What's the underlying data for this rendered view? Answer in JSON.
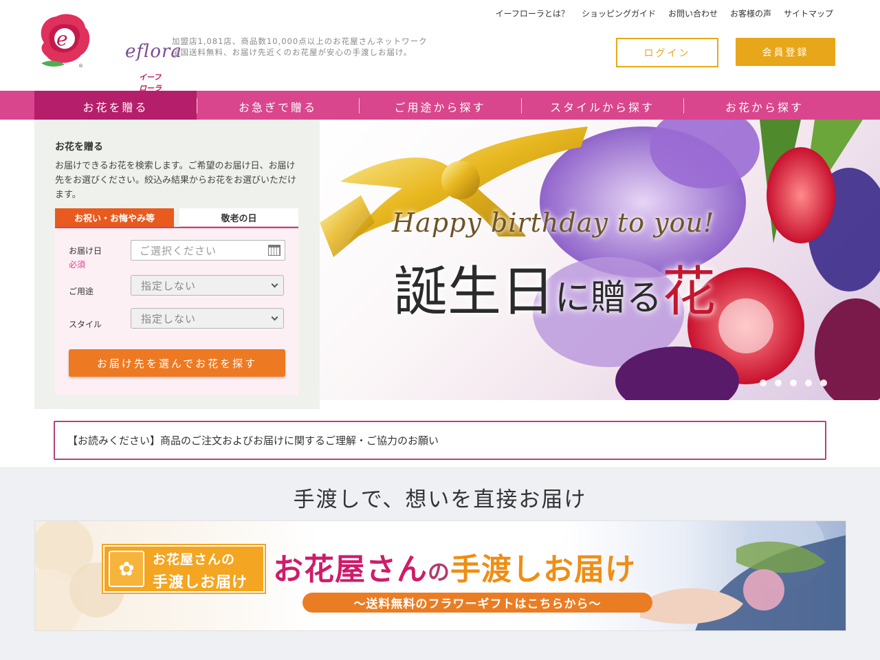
{
  "header": {
    "logo_text": "eflora",
    "logo_sub": "イーフローラ",
    "tagline_line1": "加盟店1,081店、商品数10,000点以上のお花屋さんネットワーク",
    "tagline_line2": "全国送料無料、お届け先近くのお花屋が安心の手渡しお届け。",
    "top_links": [
      "イーフローラとは？",
      "ショッピングガイド",
      "お問い合わせ",
      "お客様の声",
      "サイトマップ"
    ],
    "login_label": "ログイン",
    "register_label": "会員登録"
  },
  "nav": {
    "items": [
      "お花を贈る",
      "お急ぎで贈る",
      "ご用途から探す",
      "スタイルから探す",
      "お花から探す"
    ]
  },
  "search_panel": {
    "title": "お花を贈る",
    "description": "お届けできるお花を検索します。ご希望のお届け日、お届け先をお選びください。絞込み結果からお花をお選びいただけます。",
    "tabs": [
      "お祝い・お悔やみ等",
      "敬老の日"
    ],
    "fields": {
      "date_label": "お届け日",
      "date_required": "必須",
      "date_placeholder": "ご選択ください",
      "purpose_label": "ご用途",
      "purpose_value": "指定しない",
      "style_label": "スタイル",
      "style_value": "指定しない"
    },
    "search_button": "お届け先を選んでお花を探す"
  },
  "hero": {
    "english": "Happy birthday to you!",
    "jp_part1": "誕生日",
    "jp_part2": "に贈る",
    "jp_part3": "花"
  },
  "notice": {
    "text": "【お読みください】商品のご注文およびお届けに関するご理解・ご協力のお願い"
  },
  "section": {
    "title": "手渡しで、想いを直接お届け"
  },
  "banner": {
    "badge_line1": "お花屋さんの",
    "badge_line2": "手渡しお届け",
    "headline_part1": "お花屋さん",
    "headline_part2": "の",
    "headline_part3": "手渡しお届け",
    "subline": "～送料無料のフラワーギフトはこちらから～"
  },
  "colors": {
    "nav_pink": "#d9468d",
    "nav_active": "#b51e6a",
    "accent_orange": "#ed7a22",
    "gold": "#e8a61a"
  }
}
